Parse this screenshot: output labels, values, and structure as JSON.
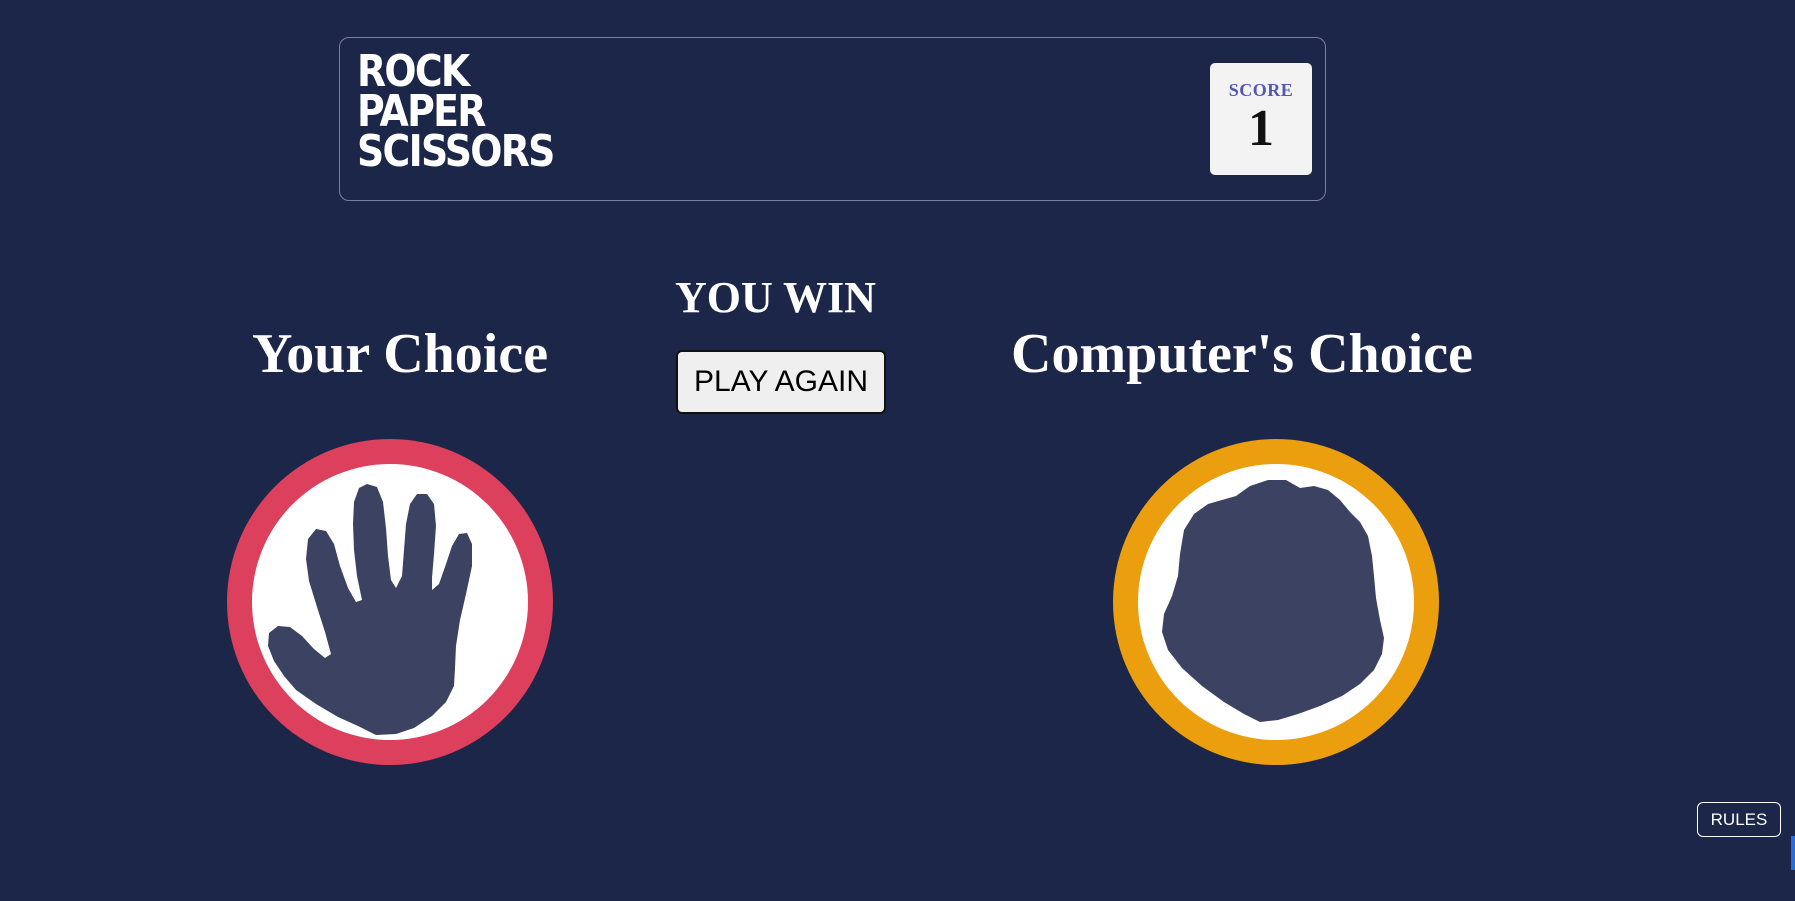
{
  "header": {
    "logo_lines": [
      "ROCK",
      "PAPER",
      "SCISSORS"
    ],
    "score_label": "SCORE",
    "score_value": "1"
  },
  "game": {
    "result": "YOU WIN",
    "play_again_label": "PLAY AGAIN",
    "player": {
      "heading": "Your Choice",
      "choice_icon": "paper-hand-icon",
      "ring_color": "#dd405d"
    },
    "computer": {
      "heading": "Computer's Choice",
      "choice_icon": "rock-fist-icon",
      "ring_color": "#eb9f0e"
    }
  },
  "footer": {
    "rules_label": "RULES"
  },
  "colors": {
    "background": "#1c2649",
    "icon_fill": "#3b4262",
    "score_label": "#5458b5"
  }
}
